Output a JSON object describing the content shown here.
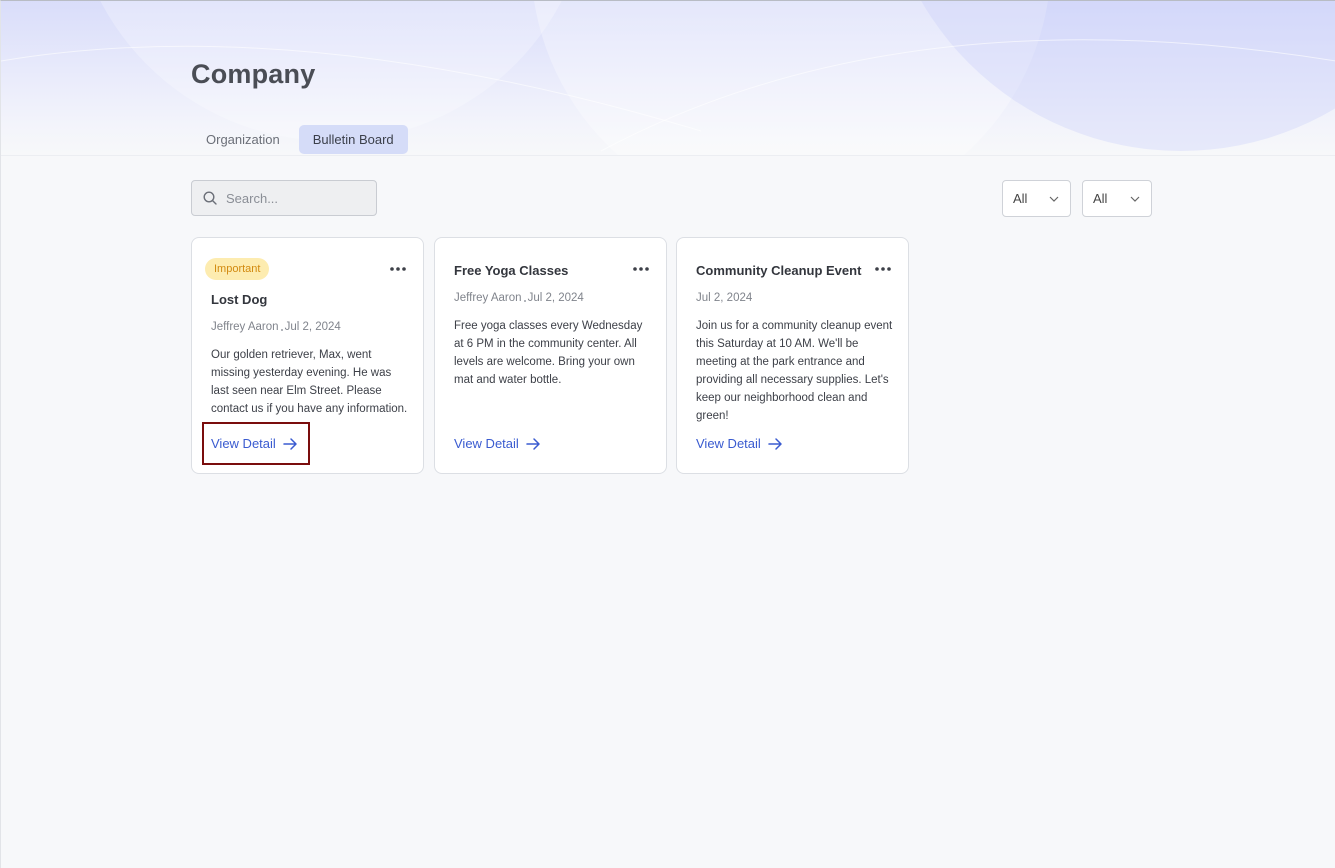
{
  "header": {
    "title": "Company"
  },
  "tabs": [
    {
      "label": "Organization",
      "active": false
    },
    {
      "label": "Bulletin Board",
      "active": true
    }
  ],
  "search": {
    "placeholder": "Search..."
  },
  "filters": [
    {
      "value": "All"
    },
    {
      "value": "All"
    }
  ],
  "posts": [
    {
      "badge": "Important",
      "title": "Lost Dog",
      "author": "Jeffrey Aaron",
      "date": "Jul 2, 2024",
      "body": "Our golden retriever, Max, went missing yesterday evening. He was last seen near Elm Street. Please contact us if you have any information.",
      "link_label": "View Detail"
    },
    {
      "title": "Free Yoga Classes",
      "author": "Jeffrey Aaron",
      "date": "Jul 2, 2024",
      "body": "Free yoga classes every Wednesday at 6 PM in the community center. All levels are welcome. Bring your own mat and water bottle.",
      "link_label": "View Detail"
    },
    {
      "title": "Community Cleanup Event",
      "date": "Jul 2, 2024",
      "body": "Join us for a community cleanup event this Saturday at 10 AM. We'll be meeting at the park entrance and providing all necessary supplies. Let's keep our neighborhood clean and green!",
      "link_label": "View Detail"
    }
  ],
  "colors": {
    "accent": "#3a5bd0",
    "tab_active_bg": "#d5dcf8",
    "badge_bg": "#fdecb0",
    "badge_text": "#d28a10",
    "highlight": "#7a0d0d"
  },
  "icons": {
    "search": "search-icon",
    "filter": "chevron-down-icon",
    "card_menu": "more-horizontal-icon",
    "link": "arrow-right-icon"
  }
}
